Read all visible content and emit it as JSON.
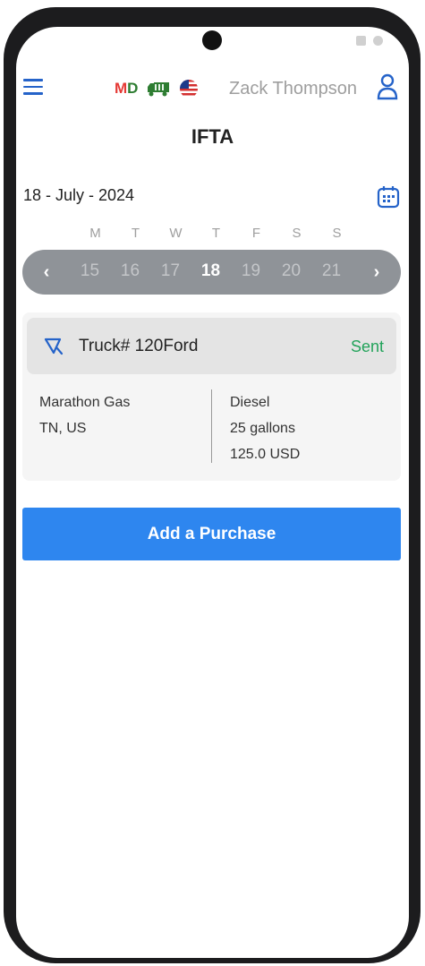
{
  "header": {
    "status_code": "M",
    "status_code_d": "D",
    "user_name": "Zack Thompson",
    "icons": [
      "menu-icon",
      "truck-icon",
      "us-flag-icon",
      "user-icon"
    ]
  },
  "page": {
    "title": "IFTA"
  },
  "date": {
    "current": "18 - July - 2024"
  },
  "week": {
    "weekdays": [
      "M",
      "T",
      "W",
      "T",
      "F",
      "S",
      "S"
    ],
    "days": [
      "15",
      "16",
      "17",
      "18",
      "19",
      "20",
      "21"
    ],
    "selected_day": "18"
  },
  "purchase": {
    "truck": "Truck# 120Ford",
    "status": "Sent",
    "station": "Marathon Gas",
    "location": "TN, US",
    "fuel_type": "Diesel",
    "quantity": "25 gallons",
    "amount": "125.0 USD"
  },
  "actions": {
    "add_label": "Add a Purchase"
  },
  "colors": {
    "accent": "#2e86ef",
    "sent": "#22a35a",
    "strip": "#8f9398",
    "md_m": "#e53935",
    "md_d": "#2e7d32"
  }
}
